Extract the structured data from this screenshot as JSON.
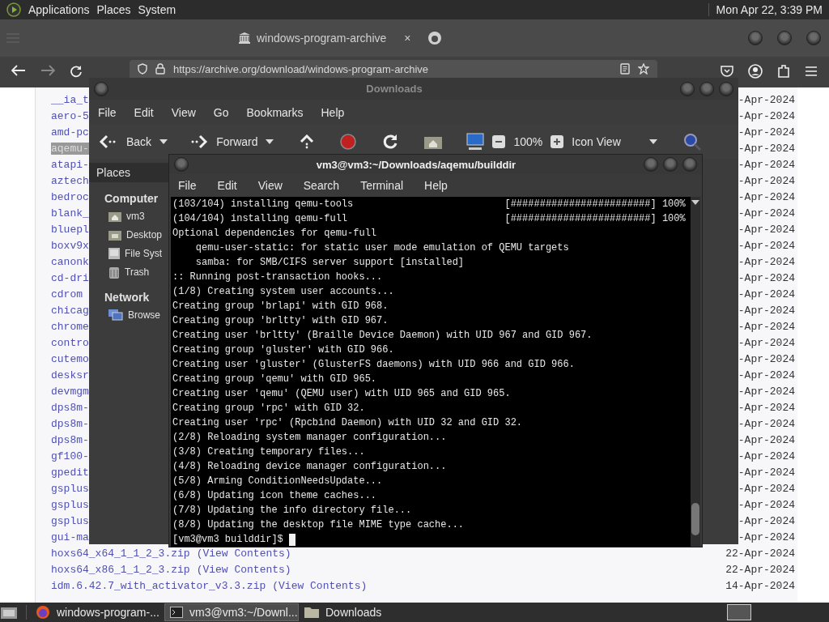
{
  "top_panel": {
    "menus": [
      "Applications",
      "Places",
      "System"
    ],
    "clock": "Mon Apr 22,  3:39 PM"
  },
  "browser": {
    "active_tab": "windows-program-archive",
    "tab_close": "×",
    "url": "https://archive.org/download/windows-program-archive",
    "listing": [
      {
        "name": "__ia_t",
        "date": "-Apr-2024",
        "selected": false
      },
      {
        "name": "aero-5",
        "date": "-Apr-2024",
        "selected": false
      },
      {
        "name": "amd-pc",
        "date": "-Apr-2024",
        "selected": false
      },
      {
        "name": "aqemu-",
        "date": "-Apr-2024",
        "selected": true
      },
      {
        "name": "atapi-",
        "date": "-Apr-2024",
        "selected": false
      },
      {
        "name": "aztech",
        "date": "-Apr-2024",
        "selected": false
      },
      {
        "name": "bedroc",
        "date": "-Apr-2024",
        "selected": false
      },
      {
        "name": "blank_",
        "date": "-Apr-2024",
        "selected": false
      },
      {
        "name": "bluepl",
        "date": "-Apr-2024",
        "selected": false
      },
      {
        "name": "boxv9x",
        "date": "-Apr-2024",
        "selected": false
      },
      {
        "name": "canonk",
        "date": "-Apr-2024",
        "selected": false
      },
      {
        "name": "cd-dri",
        "date": "-Apr-2024",
        "selected": false
      },
      {
        "name": "cdrom",
        "date": "-Apr-2024",
        "selected": false
      },
      {
        "name": "chicag",
        "date": "-Apr-2024",
        "selected": false
      },
      {
        "name": "chrome",
        "date": "-Apr-2024",
        "selected": false
      },
      {
        "name": "contro",
        "date": "-Apr-2024",
        "selected": false
      },
      {
        "name": "cutemo",
        "date": "-Apr-2024",
        "selected": false
      },
      {
        "name": "desksr",
        "date": "-Apr-2024",
        "selected": false
      },
      {
        "name": "devmgm",
        "date": "-Apr-2024",
        "selected": false
      },
      {
        "name": "dps8m-",
        "date": "-Apr-2024",
        "selected": false
      },
      {
        "name": "dps8m-",
        "date": "-Apr-2024",
        "selected": false
      },
      {
        "name": "dps8m-",
        "date": "-Apr-2024",
        "selected": false
      },
      {
        "name": "gf100-",
        "date": "-Apr-2024",
        "selected": false
      },
      {
        "name": "gpedit",
        "date": "-Apr-2024",
        "selected": false
      },
      {
        "name": "gsplus",
        "date": "-Apr-2024",
        "selected": false
      },
      {
        "name": "gsplus",
        "date": "-Apr-2024",
        "selected": false
      },
      {
        "name": "gsplus",
        "date": "-Apr-2024",
        "selected": false
      },
      {
        "name": "gui-ma",
        "date": "-Apr-2024",
        "selected": false
      },
      {
        "name": "hoxs64_x64_1_1_2_3.zip",
        "link": "(View Contents)",
        "date": "22-Apr-2024",
        "selected": false
      },
      {
        "name": "hoxs64_x86_1_1_2_3.zip",
        "link": "(View Contents)",
        "date": "22-Apr-2024",
        "selected": false
      },
      {
        "name": "idm.6.42.7_with_activator_v3.3.zip",
        "link": "(View Contents)",
        "date": "14-Apr-2024",
        "selected": false
      }
    ]
  },
  "file_manager": {
    "title": "Downloads",
    "menus": [
      "File",
      "Edit",
      "View",
      "Go",
      "Bookmarks",
      "Help"
    ],
    "toolbar": {
      "back": "Back",
      "forward": "Forward",
      "zoom": "100%",
      "view": "Icon View"
    },
    "sidebar": {
      "header": "Places",
      "sections": [
        {
          "title": "Computer",
          "items": [
            {
              "label": "vm3",
              "kind": "home"
            },
            {
              "label": "Desktop",
              "kind": "desktop"
            },
            {
              "label": "File Syst",
              "kind": "drive"
            },
            {
              "label": "Trash",
              "kind": "trash"
            }
          ]
        },
        {
          "title": "Network",
          "items": [
            {
              "label": "Browse",
              "kind": "network"
            }
          ]
        }
      ]
    }
  },
  "terminal": {
    "title": "vm3@vm3:~/Downloads/aqemu/builddir",
    "menus": [
      "File",
      "Edit",
      "View",
      "Search",
      "Terminal",
      "Help"
    ],
    "lines": [
      "(103/104) installing qemu-tools                          [########################] 100%",
      "(104/104) installing qemu-full                           [########################] 100%",
      "Optional dependencies for qemu-full",
      "    qemu-user-static: for static user mode emulation of QEMU targets",
      "    samba: for SMB/CIFS server support [installed]",
      ":: Running post-transaction hooks...",
      "(1/8) Creating system user accounts...",
      "Creating group 'brlapi' with GID 968.",
      "Creating group 'brltty' with GID 967.",
      "Creating user 'brltty' (Braille Device Daemon) with UID 967 and GID 967.",
      "Creating group 'gluster' with GID 966.",
      "Creating user 'gluster' (GlusterFS daemons) with UID 966 and GID 966.",
      "Creating group 'qemu' with GID 965.",
      "Creating user 'qemu' (QEMU user) with UID 965 and GID 965.",
      "Creating group 'rpc' with GID 32.",
      "Creating user 'rpc' (Rpcbind Daemon) with UID 32 and GID 32.",
      "(2/8) Reloading system manager configuration...",
      "(3/8) Creating temporary files...",
      "(4/8) Reloading device manager configuration...",
      "(5/8) Arming ConditionNeedsUpdate...",
      "(6/8) Updating icon theme caches...",
      "(7/8) Updating the info directory file...",
      "(8/8) Updating the desktop file MIME type cache..."
    ],
    "prompt": "[vm3@vm3 builddir]$"
  },
  "taskbar": {
    "items": [
      {
        "label": "windows-program-...",
        "kind": "browser",
        "selected": false
      },
      {
        "label": "vm3@vm3:~/Downl...",
        "kind": "terminal",
        "selected": true
      },
      {
        "label": "Downloads",
        "kind": "folder",
        "selected": false
      }
    ]
  }
}
